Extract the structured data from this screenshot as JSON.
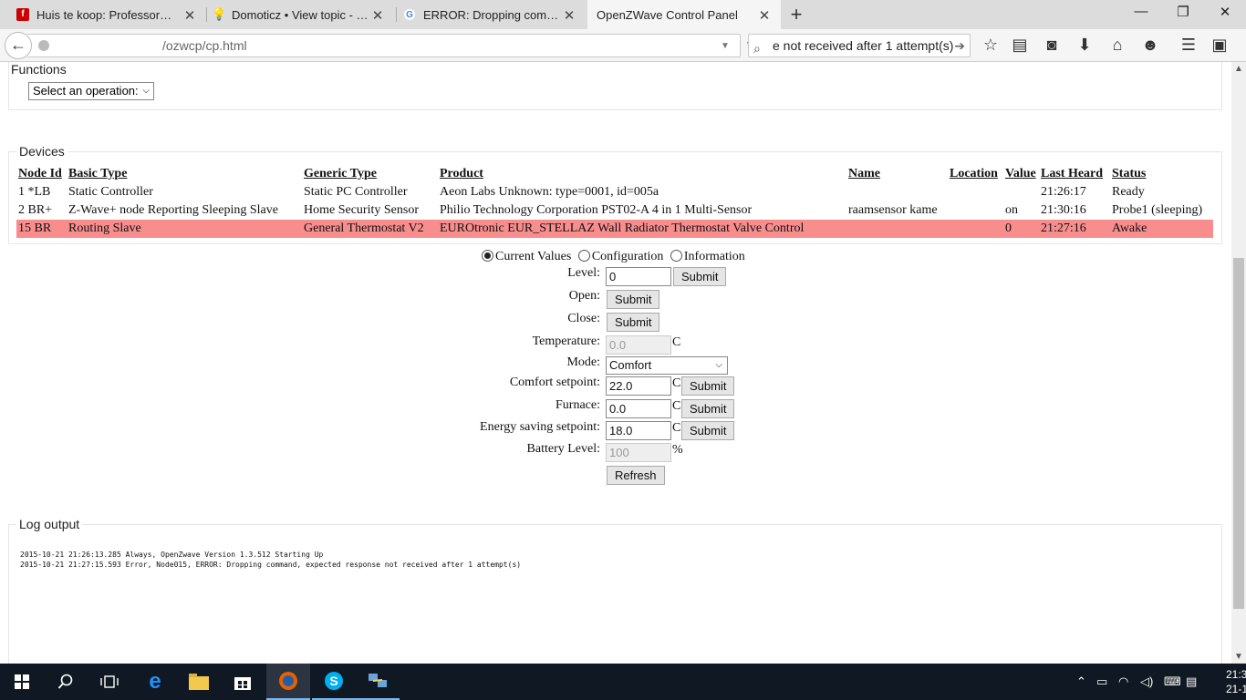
{
  "browser": {
    "tabs": [
      {
        "title": "Huis te koop: Professor Ke...",
        "favicon": "funda-icon",
        "active": false
      },
      {
        "title": "Domoticz • View topic - E...",
        "favicon": "lightbulb-icon",
        "active": false
      },
      {
        "title": "ERROR: Dropping comma...",
        "favicon": "google-icon",
        "active": false
      },
      {
        "title": "OpenZWave Control Panel",
        "favicon": "",
        "active": true
      }
    ],
    "url": "/ozwcp/cp.html",
    "search_text": "e not received after 1 attempt(s)"
  },
  "functions": {
    "legend": "Functions",
    "operation_select": "Select an operation:"
  },
  "devices": {
    "legend": "Devices",
    "columns": [
      "Node Id",
      "Basic Type",
      "Generic Type",
      "Product",
      "Name",
      "Location",
      "Value",
      "Last Heard",
      "Status"
    ],
    "rows": [
      {
        "node": "1 *LB",
        "basic": "Static Controller",
        "generic": "Static PC Controller",
        "product": "Aeon Labs Unknown: type=0001, id=005a",
        "name": "",
        "location": "",
        "value": "",
        "last": "21:26:17",
        "status": "Ready",
        "selected": false
      },
      {
        "node": "2 BR+",
        "basic": "Z-Wave+ node Reporting Sleeping Slave",
        "generic": "Home Security Sensor",
        "product": "Philio Technology Corporation PST02-A 4 in 1 Multi-Sensor",
        "name": "raamsensor kame",
        "location": "",
        "value": "on",
        "last": "21:30:16",
        "status": "Probe1 (sleeping)",
        "selected": false
      },
      {
        "node": "15 BR",
        "basic": "Routing Slave",
        "generic": "General Thermostat V2",
        "product": "EUROtronic EUR_STELLAZ Wall Radiator Thermostat Valve Control",
        "name": "",
        "location": "",
        "value": "0",
        "last": "21:27:16",
        "status": "Awake",
        "selected": true
      }
    ]
  },
  "panel": {
    "radios": [
      {
        "label": "Current Values",
        "checked": true
      },
      {
        "label": "Configuration",
        "checked": false
      },
      {
        "label": "Information",
        "checked": false
      }
    ],
    "level_label": "Level:",
    "level_value": "0",
    "open_label": "Open:",
    "close_label": "Close:",
    "temperature_label": "Temperature:",
    "temperature_value": "0.0",
    "mode_label": "Mode:",
    "mode_value": "Comfort",
    "comfort_label": "Comfort setpoint:",
    "comfort_value": "22.0",
    "furnace_label": "Furnace:",
    "furnace_value": "0.0",
    "energy_label": "Energy saving setpoint:",
    "energy_value": "18.0",
    "battery_label": "Battery Level:",
    "battery_value": "100",
    "unit_c": "C",
    "unit_pct": "%",
    "submit_label": "Submit",
    "refresh_label": "Refresh"
  },
  "log": {
    "legend": "Log output",
    "lines": [
      "2015-10-21 21:26:13.285 Always, OpenZwave Version 1.3.512 Starting Up",
      "2015-10-21 21:27:15.593 Error, Node015, ERROR: Dropping command, expected response not received after 1 attempt(s)"
    ]
  },
  "taskbar": {
    "time": "21:3",
    "date": "21-10-"
  }
}
